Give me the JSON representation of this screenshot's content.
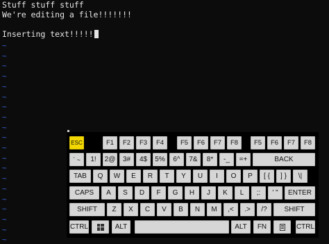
{
  "terminal": {
    "lines": [
      "Stuff stuff stuff",
      "We're editing a file!!!!!!!",
      "",
      "Inserting text!!!!!"
    ],
    "tilde": "~"
  },
  "keyboard": {
    "row_f": [
      "ESC",
      "F1",
      "F2",
      "F3",
      "F4",
      "F5",
      "F6",
      "F7",
      "F8",
      "F5",
      "F6",
      "F7",
      "F8"
    ],
    "row_num": [
      "` ~",
      "1!",
      "2@",
      "3#",
      "4$",
      "5%",
      "6^",
      "7&",
      "8*",
      "-_",
      "=+",
      "BACK"
    ],
    "row_tab": [
      "TAB",
      "Q",
      "W",
      "E",
      "R",
      "T",
      "Y",
      "U",
      "I",
      "O",
      "P",
      "[ {",
      "] }",
      "\\|"
    ],
    "row_caps": [
      "CAPS",
      "A",
      "S",
      "D",
      "F",
      "G",
      "H",
      "J",
      "K",
      "L",
      ";:",
      "' \"",
      "ENTER"
    ],
    "row_shift": [
      "SHIFT",
      "Z",
      "X",
      "C",
      "V",
      "B",
      "N",
      "M",
      ",<",
      ".>",
      "/?",
      "SHIFT"
    ],
    "row_bottom": {
      "ctrl_left": "CTRL",
      "alt_left": "ALT",
      "alt_right": "ALT",
      "fn": "FN",
      "ctrl_right": "CTRL"
    },
    "icons": {
      "windows": "windows-icon",
      "menu": "menu-icon"
    },
    "colors": {
      "esc": "#f2d800",
      "key": "#d6d6d6",
      "background": "#000000"
    }
  }
}
